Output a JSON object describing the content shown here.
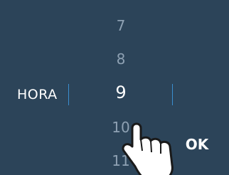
{
  "picker": {
    "label": "HORA",
    "hours": [
      "7",
      "8",
      "9",
      "10",
      "11"
    ],
    "selected": "9"
  },
  "actions": {
    "ok_label": "OK"
  },
  "colors": {
    "background": "#2c4459",
    "text_selected": "#ffffff",
    "text_dimmed": "#8ea1b3",
    "divider": "#3a8fd0"
  },
  "icons": {
    "gesture": "pointing-hand-icon"
  }
}
